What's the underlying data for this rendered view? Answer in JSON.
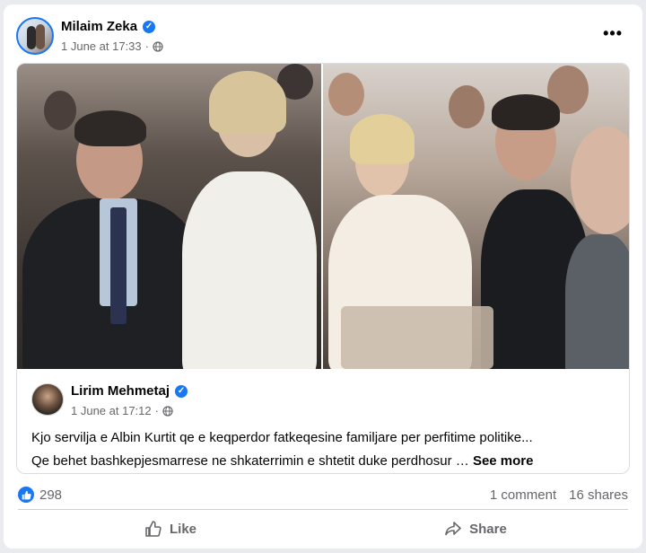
{
  "post": {
    "author": "Milaim Zeka",
    "timestamp": "1 June at 17:33",
    "more_label": "•••"
  },
  "shared": {
    "author": "Lirim Mehmetaj",
    "timestamp": "1 June at 17:12",
    "text_line1": "Kjo servilja e Albin Kurtit qe e keqperdor fatkeqesine familjare per perfitime politike...",
    "text_line2": "Qe behet bashkepjesmarrese ne shkaterrimin e shtetit duke perdhosur …",
    "see_more": "See more"
  },
  "stats": {
    "reactions": "298",
    "comments": "1 comment",
    "shares": "16 shares"
  },
  "actions": {
    "like": "Like",
    "share": "Share"
  },
  "icons": {
    "verified": "verified-badge-icon",
    "audience": "globe-icon",
    "like_reaction": "thumbs-up-icon",
    "share": "share-arrow-icon"
  },
  "colors": {
    "accent": "#1877f2",
    "muted_text": "#65676b",
    "background": "#e9ebee"
  }
}
